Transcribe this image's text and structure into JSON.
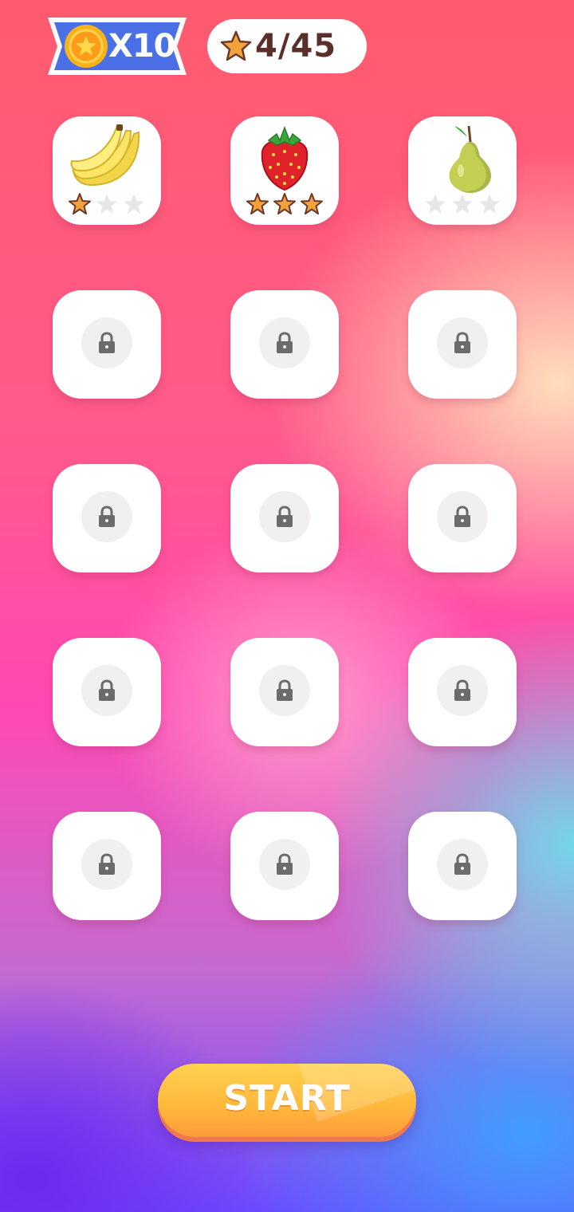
{
  "header": {
    "coins_label": "X10",
    "stars_label": "4/45",
    "colors": {
      "badge_blue": "#4a6fe6",
      "coin_gold": "#f6b41a",
      "star_text": "#5a2f2a"
    }
  },
  "levels": [
    {
      "fruit": "banana-icon",
      "stars_earned": 1,
      "locked": false
    },
    {
      "fruit": "strawberry-icon",
      "stars_earned": 3,
      "locked": false
    },
    {
      "fruit": "pear-icon",
      "stars_earned": 0,
      "locked": false
    },
    {
      "locked": true
    },
    {
      "locked": true
    },
    {
      "locked": true
    },
    {
      "locked": true
    },
    {
      "locked": true
    },
    {
      "locked": true
    },
    {
      "locked": true
    },
    {
      "locked": true
    },
    {
      "locked": true
    },
    {
      "locked": true
    },
    {
      "locked": true
    },
    {
      "locked": true
    }
  ],
  "start_button": {
    "label": "START",
    "color": "#ffb83c"
  }
}
